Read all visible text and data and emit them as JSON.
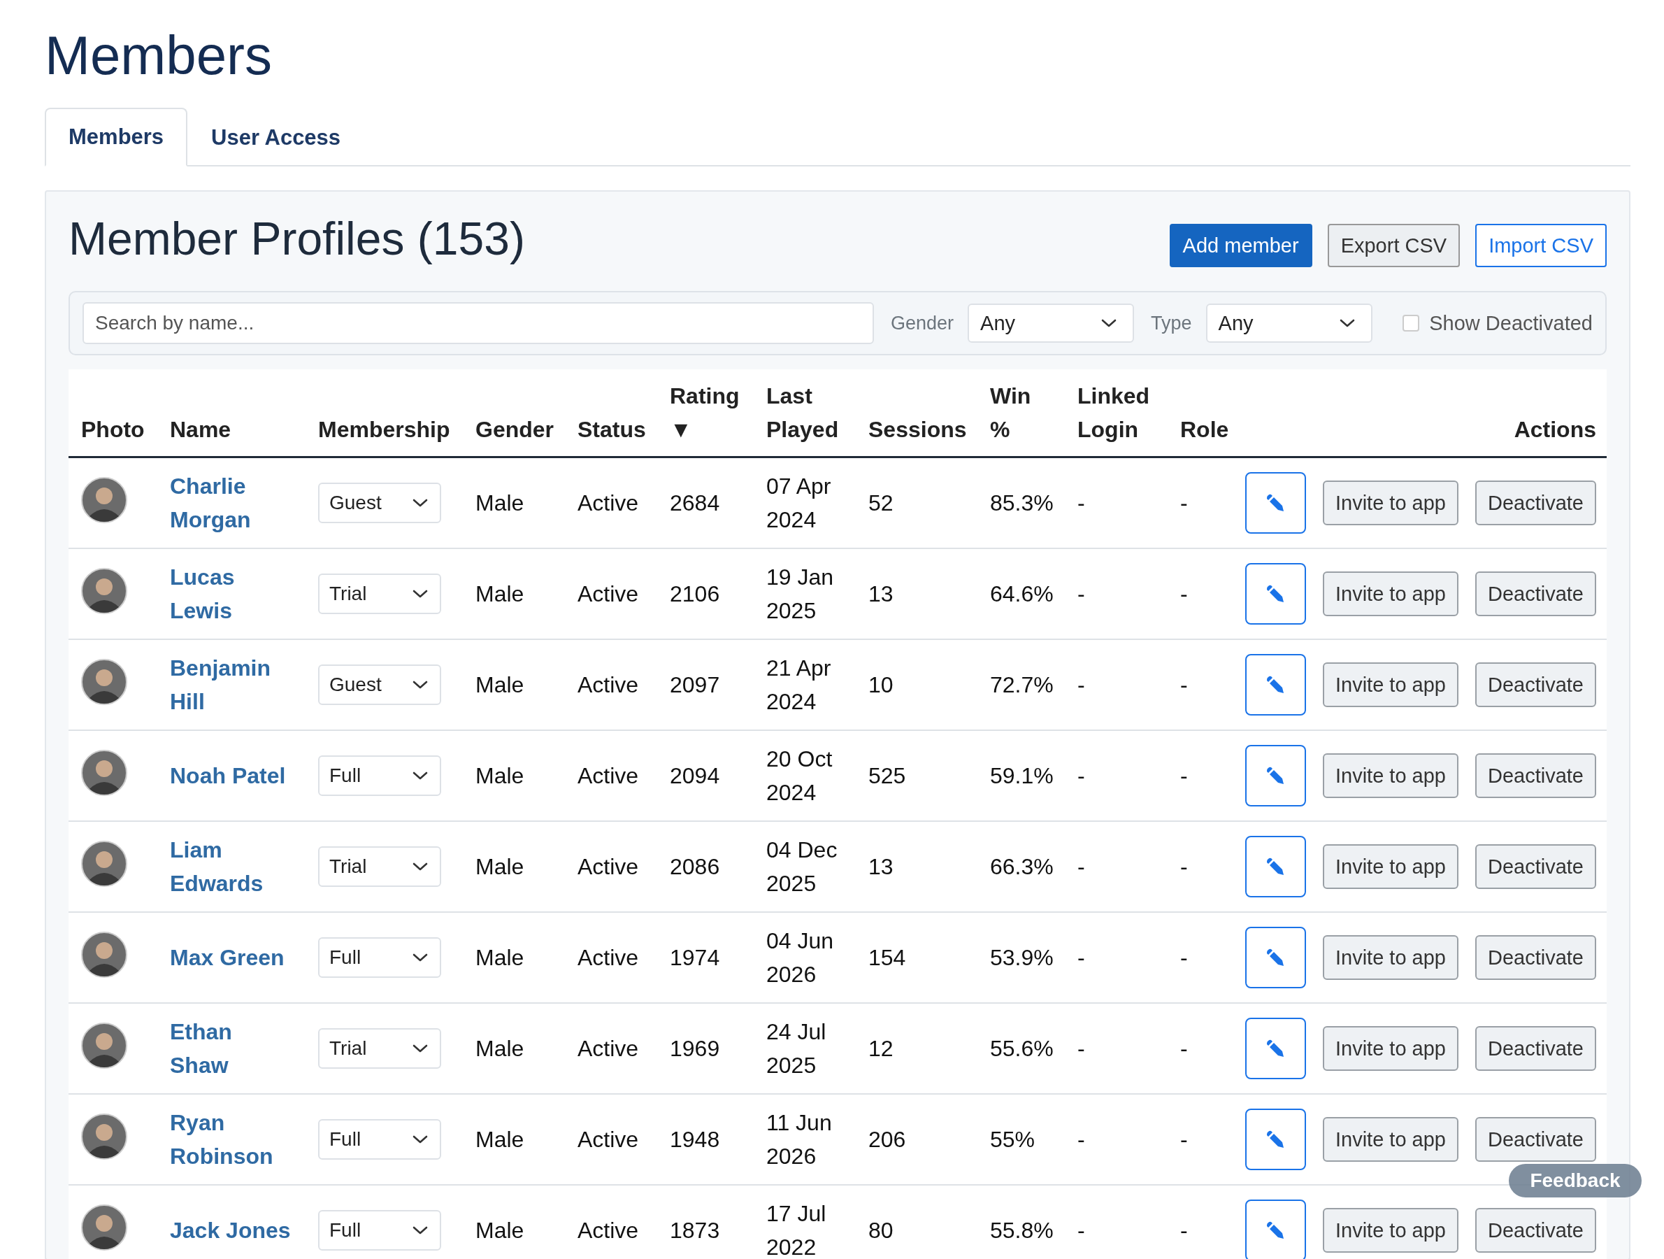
{
  "page_title": "Members",
  "tabs": [
    {
      "label": "Members",
      "selected": true
    },
    {
      "label": "User Access",
      "selected": false
    }
  ],
  "card": {
    "title": "Member Profiles (153)",
    "buttons": [
      {
        "label": "Add member",
        "kind": "primary"
      },
      {
        "label": "Export CSV",
        "kind": "secondary"
      },
      {
        "label": "Import CSV",
        "kind": "outline"
      }
    ]
  },
  "filters": {
    "search": {
      "placeholder": "Search by name..."
    },
    "gender": {
      "label": "Gender",
      "value": "Any"
    },
    "type": {
      "label": "Type",
      "value": "Any"
    },
    "show_deactivated": {
      "label": "Show Deactivated",
      "checked": false
    }
  },
  "table": {
    "columns": [
      "Photo",
      "Name",
      "Membership",
      "Gender",
      "Status",
      "Rating ▼",
      "Last Played",
      "Sessions",
      "Win %",
      "Linked Login",
      "Role",
      "Actions"
    ],
    "rows": [
      {
        "name": "Charlie Morgan",
        "membership": "Guest",
        "gender": "Male",
        "status": "Active",
        "rating": "2684",
        "last_played": "07 Apr 2024",
        "sessions": "52",
        "win": "85.3%",
        "linked_login": "-",
        "role": "-",
        "actions": [
          "Invite to app",
          "Deactivate"
        ]
      },
      {
        "name": "Lucas Lewis",
        "membership": "Trial",
        "gender": "Male",
        "status": "Active",
        "rating": "2106",
        "last_played": "19 Jan 2025",
        "sessions": "13",
        "win": "64.6%",
        "linked_login": "-",
        "role": "-",
        "actions": [
          "Invite to app",
          "Deactivate"
        ]
      },
      {
        "name": "Benjamin Hill",
        "membership": "Guest",
        "gender": "Male",
        "status": "Active",
        "rating": "2097",
        "last_played": "21 Apr 2024",
        "sessions": "10",
        "win": "72.7%",
        "linked_login": "-",
        "role": "-",
        "actions": [
          "Invite to app",
          "Deactivate"
        ]
      },
      {
        "name": "Noah Patel",
        "membership": "Full",
        "gender": "Male",
        "status": "Active",
        "rating": "2094",
        "last_played": "20 Oct 2024",
        "sessions": "525",
        "win": "59.1%",
        "linked_login": "-",
        "role": "-",
        "actions": [
          "Invite to app",
          "Deactivate"
        ]
      },
      {
        "name": "Liam Edwards",
        "membership": "Trial",
        "gender": "Male",
        "status": "Active",
        "rating": "2086",
        "last_played": "04 Dec 2025",
        "sessions": "13",
        "win": "66.3%",
        "linked_login": "-",
        "role": "-",
        "actions": [
          "Invite to app",
          "Deactivate"
        ]
      },
      {
        "name": "Max Green",
        "membership": "Full",
        "gender": "Male",
        "status": "Active",
        "rating": "1974",
        "last_played": "04 Jun 2026",
        "sessions": "154",
        "win": "53.9%",
        "linked_login": "-",
        "role": "-",
        "actions": [
          "Invite to app",
          "Deactivate"
        ]
      },
      {
        "name": "Ethan Shaw",
        "membership": "Trial",
        "gender": "Male",
        "status": "Active",
        "rating": "1969",
        "last_played": "24 Jul 2025",
        "sessions": "12",
        "win": "55.6%",
        "linked_login": "-",
        "role": "-",
        "actions": [
          "Invite to app",
          "Deactivate"
        ]
      },
      {
        "name": "Ryan Robinson",
        "membership": "Full",
        "gender": "Male",
        "status": "Active",
        "rating": "1948",
        "last_played": "11 Jun 2026",
        "sessions": "206",
        "win": "55%",
        "linked_login": "-",
        "role": "-",
        "actions": [
          "Invite to app",
          "Deactivate"
        ]
      },
      {
        "name": "Jack Jones",
        "membership": "Full",
        "gender": "Male",
        "status": "Active",
        "rating": "1873",
        "last_played": "17 Jul 2022",
        "sessions": "80",
        "win": "55.8%",
        "linked_login": "-",
        "role": "-",
        "actions": [
          "Invite to app",
          "Deactivate"
        ]
      }
    ]
  },
  "feedback_button": "Feedback"
}
